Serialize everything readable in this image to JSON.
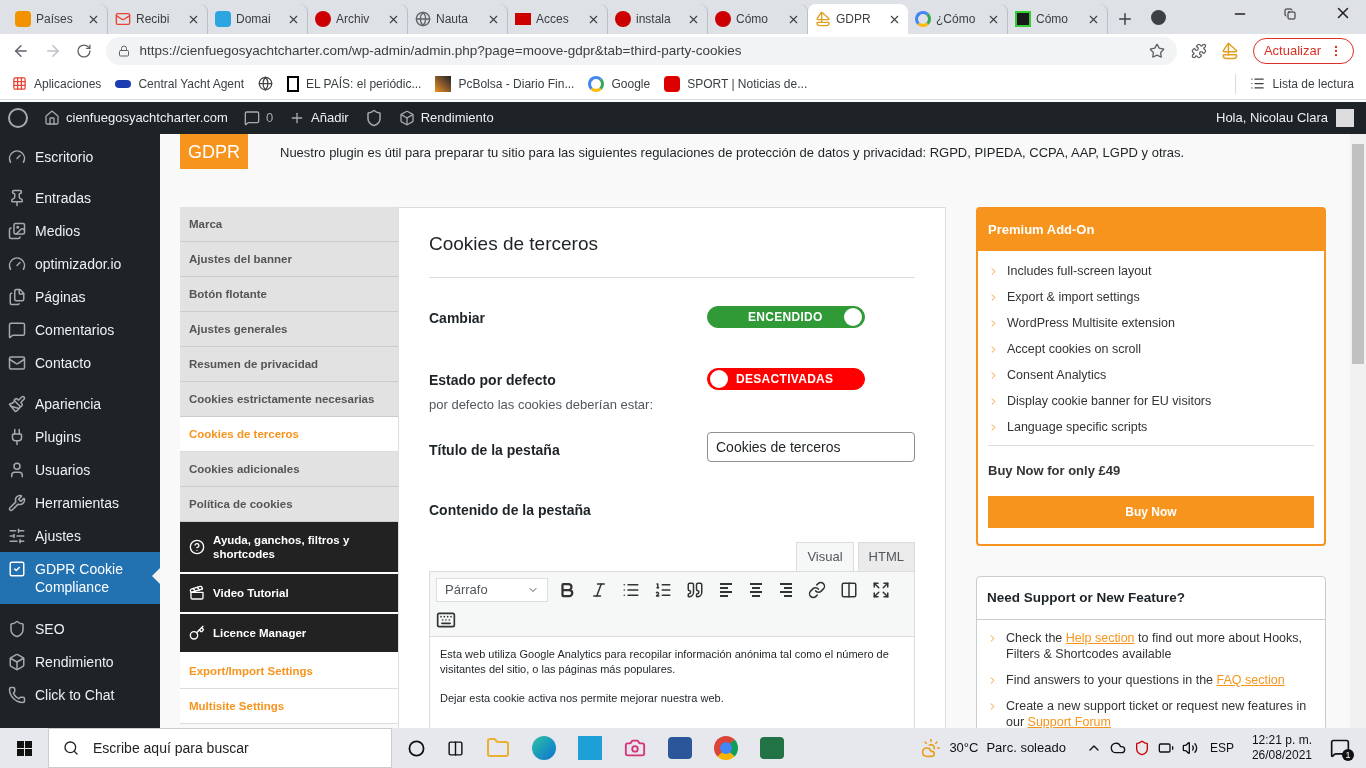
{
  "browser": {
    "tabs": [
      {
        "title": "Países",
        "kind": "rtve",
        "selected": false
      },
      {
        "title": "Recibi",
        "kind": "mail",
        "selected": false
      },
      {
        "title": "Domai",
        "kind": "m",
        "selected": false
      },
      {
        "title": "Archiv",
        "kind": "w",
        "selected": false
      },
      {
        "title": "Nauta",
        "kind": "globe",
        "selected": false
      },
      {
        "title": "Acces",
        "kind": "w2",
        "selected": false
      },
      {
        "title": "instala",
        "kind": "w",
        "selected": false
      },
      {
        "title": "Cómo",
        "kind": "w",
        "selected": false
      },
      {
        "title": "GDPR",
        "kind": "sail",
        "selected": true
      },
      {
        "title": "¿Cómo",
        "kind": "g",
        "selected": false
      },
      {
        "title": "Cómo",
        "kind": "x",
        "selected": false
      }
    ],
    "url": "https://cienfuegosyachtcharter.com/wp-admin/admin.php?page=moove-gdpr&tab=third-party-cookies",
    "update_button": "Actualizar",
    "bookmarks": [
      {
        "title": "Aplicaciones",
        "kind": "apps"
      },
      {
        "title": "Central Yacht Agent",
        "kind": "cya"
      },
      {
        "kind": "globe"
      },
      {
        "title": "EL PAÍS: el periódic...",
        "kind": "e"
      },
      {
        "title": "PcBolsa - Diario Fin...",
        "kind": "chart"
      },
      {
        "title": "Google",
        "kind": "g"
      },
      {
        "title": "SPORT | Noticias de...",
        "kind": "s"
      }
    ],
    "reading_list": "Lista de lectura"
  },
  "admin_bar": {
    "site": "cienfuegosyachtcharter.com",
    "comments": "0",
    "add": "Añadir",
    "performance": "Rendimiento",
    "greeting": "Hola, Nicolau Clara"
  },
  "sidebar": {
    "groups": [
      [
        {
          "label": "Escritorio",
          "selected": false
        }
      ],
      [
        {
          "label": "Entradas",
          "selected": false
        },
        {
          "label": "Medios",
          "selected": false
        },
        {
          "label": "optimizador.io",
          "selected": false
        },
        {
          "label": "Páginas",
          "selected": false
        },
        {
          "label": "Comentarios",
          "selected": false
        },
        {
          "label": "Contacto",
          "selected": false
        }
      ],
      [
        {
          "label": "Apariencia",
          "selected": false
        },
        {
          "label": "Plugins",
          "selected": false
        },
        {
          "label": "Usuarios",
          "selected": false
        },
        {
          "label": "Herramientas",
          "selected": false
        },
        {
          "label": "Ajustes",
          "selected": false
        },
        {
          "label": "GDPR Cookie Compliance",
          "selected": true
        }
      ],
      [
        {
          "label": "SEO",
          "selected": false
        },
        {
          "label": "Rendimiento",
          "selected": false
        },
        {
          "label": "Click to Chat",
          "selected": false
        }
      ]
    ]
  },
  "plugin_header": {
    "logo": "GDPR",
    "description": "Nuestro plugin es útil para preparar tu sitio para las siguientes regulaciones de protección de datos y privacidad: RGPD, PIPEDA, CCPA, AAP, LGPD y otras."
  },
  "settings_nav": [
    {
      "label": "Marca",
      "kind": "tab",
      "selected": false
    },
    {
      "label": "Ajustes del banner",
      "kind": "tab",
      "selected": false
    },
    {
      "label": "Botón flotante",
      "kind": "tab",
      "selected": false
    },
    {
      "label": "Ajustes generales",
      "kind": "tab",
      "selected": false
    },
    {
      "label": "Resumen de privacidad",
      "kind": "tab",
      "selected": false
    },
    {
      "label": "Cookies estrictamente necesarias",
      "kind": "tab",
      "selected": false
    },
    {
      "label": "Cookies de terceros",
      "kind": "tab",
      "selected": true
    },
    {
      "label": "Cookies adicionales",
      "kind": "tab",
      "selected": false
    },
    {
      "label": "Política de cookies",
      "kind": "tab",
      "selected": false
    },
    {
      "label": "Ayuda, ganchos, filtros y shortcodes",
      "kind": "help"
    },
    {
      "label": "Video Tutorial",
      "kind": "video"
    },
    {
      "label": "Licence Manager",
      "kind": "licence"
    },
    {
      "label": "Export/Import Settings",
      "kind": "link"
    },
    {
      "label": "Multisite Settings",
      "kind": "link"
    }
  ],
  "panel": {
    "title": "Cookies de terceros",
    "fields": [
      {
        "kind": "toggle",
        "label": "Cambiar",
        "on": true,
        "state_text": "ENCENDIDO"
      },
      {
        "kind": "toggle",
        "label": "Estado por defecto",
        "sublabel": "por defecto las cookies deberían estar:",
        "on": false,
        "state_text": "DESACTIVADAS"
      },
      {
        "kind": "input",
        "label": "Título de la pestaña",
        "value": "Cookies de terceros"
      },
      {
        "kind": "heading",
        "label": "Contenido de la pestaña"
      }
    ],
    "editor": {
      "tabs": [
        {
          "label": "Visual",
          "selected": true
        },
        {
          "label": "HTML",
          "selected": false
        }
      ],
      "format": "Párrafo",
      "paragraphs": [
        "Esta web utiliza Google Analytics para recopilar información anónima tal como el número de visitantes del sitio, o las páginas más populares.",
        "Dejar esta cookie activa nos permite mejorar nuestra web."
      ]
    }
  },
  "premium": {
    "title": "Premium Add-On",
    "features": [
      "Includes full-screen layout",
      "Export & import settings",
      "WordPress Multisite extension",
      "Accept cookies on scroll",
      "Consent Analytics",
      "Display cookie banner for EU visitors",
      "Language specific scripts"
    ],
    "price": "Buy Now for only £49",
    "button": "Buy Now"
  },
  "support": {
    "title": "Need Support or New Feature?",
    "items": [
      {
        "before": "Check the ",
        "link": "Help section",
        "after": " to find out more about Hooks, Filters & Shortcodes available"
      },
      {
        "before": "Find answers to your questions in the ",
        "link": "FAQ section"
      },
      {
        "before": "Create a new support ticket or request new features in our ",
        "link": "Support Forum"
      }
    ]
  },
  "taskbar": {
    "search_placeholder": "Escribe aquí para buscar",
    "temperature": "30°C",
    "weather": "Parc. soleado",
    "language": "ESP",
    "time": "12:21 p. m.",
    "date": "26/08/2021",
    "notifications": "1"
  }
}
